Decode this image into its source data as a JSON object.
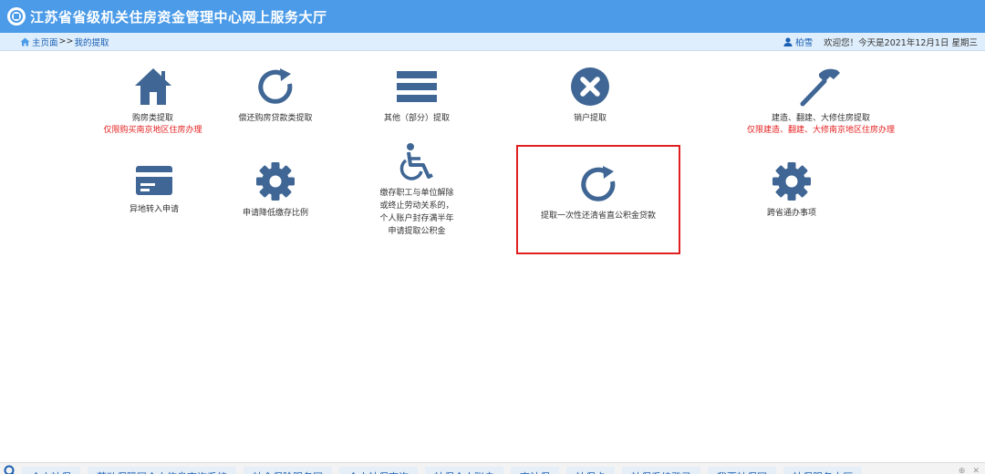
{
  "header": {
    "title": "江苏省省级机关住房资金管理中心网上服务大厅"
  },
  "breadcrumb": {
    "home": "主页面",
    "separator": ">>",
    "current": "我的提取"
  },
  "user": {
    "name": "柏雪",
    "greeting": "欢迎您！今天是2021年12月1日 星期三"
  },
  "tiles": [
    {
      "label": "购房类提取",
      "note": "仅限购买南京地区住房办理",
      "icon": "house-icon"
    },
    {
      "label": "偿还购房贷款类提取",
      "icon": "refresh-icon"
    },
    {
      "label": "其他（部分）提取",
      "icon": "menu-icon"
    },
    {
      "label": "销户提取",
      "icon": "close-circle-icon"
    },
    {
      "label": "建造、翻建、大修住房提取",
      "note": "仅限建造、翻建、大修南京地区住房办理",
      "icon": "hammer-icon"
    },
    {
      "label": "异地转入申请",
      "icon": "card-icon"
    },
    {
      "label": "申请降低缴存比例",
      "icon": "gear-icon"
    },
    {
      "label_lines": [
        "缴存职工与单位解除",
        "或终止劳动关系的，",
        "个人账户封存满半年",
        "申请提取公积金"
      ],
      "icon": "wheelchair-icon"
    },
    {
      "label": "提取一次性还清省直公积金贷款",
      "icon": "refresh-icon"
    },
    {
      "label": "跨省通办事项",
      "icon": "gear-icon"
    }
  ],
  "colors": {
    "accent": "#4b9be8",
    "icon": "#3f6694",
    "highlight": "#e02020",
    "note": "#e52222"
  },
  "taskbar": {
    "tabs": [
      "个人社保",
      "劳动保障网个人信息查询系统",
      "社会保险服务网",
      "个人社保查询",
      "社保个人账户",
      "查社保",
      "社保卡",
      "社保系统登录",
      "我要社保网",
      "社保服务大厅"
    ]
  }
}
